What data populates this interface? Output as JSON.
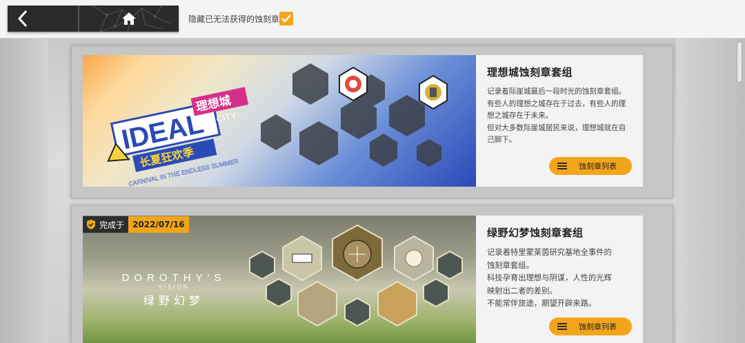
{
  "topbar": {
    "back_icon": "chevron-left-icon",
    "home_icon": "home-icon",
    "hide_label": "隐藏已无法获得的蚀刻章",
    "hide_checked": true,
    "accent": "#f2a51b"
  },
  "cards": [
    {
      "logo_line1": "IDEAL",
      "logo_city_cn": "理想城",
      "logo_city_en": "CITY",
      "logo_sub_cn": "长夏狂欢季",
      "logo_sub_en": "CARNIVAL IN THE ENDLESS SUMMER",
      "title": "理想城蚀刻章套组",
      "desc": [
        "记录着际崖城最后一段时光的蚀刻章套组。",
        "有些人的理想之城存在于过去，有些人的理",
        "想之城存在于未来。",
        "但对大多数际崖城居民来说，理想城就在自",
        "己脚下。"
      ],
      "button": "蚀刻章列表"
    },
    {
      "complete_label": "完成于",
      "complete_date": "2022/07/16",
      "logo_en": "DOROTHY'S",
      "logo_sub_en": "VISION",
      "logo_cn": "绿野幻梦",
      "title": "绿野幻梦蚀刻章套组",
      "desc": [
        "记录着特里蒙莱茵研究基地全事件的",
        "蚀刻章套组。",
        "科技孕育出理想与阴谋，人性的光辉",
        "映射出二者的差别。",
        "不能常伴旅途，期望开辟来路。"
      ],
      "button": "蚀刻章列表"
    }
  ]
}
